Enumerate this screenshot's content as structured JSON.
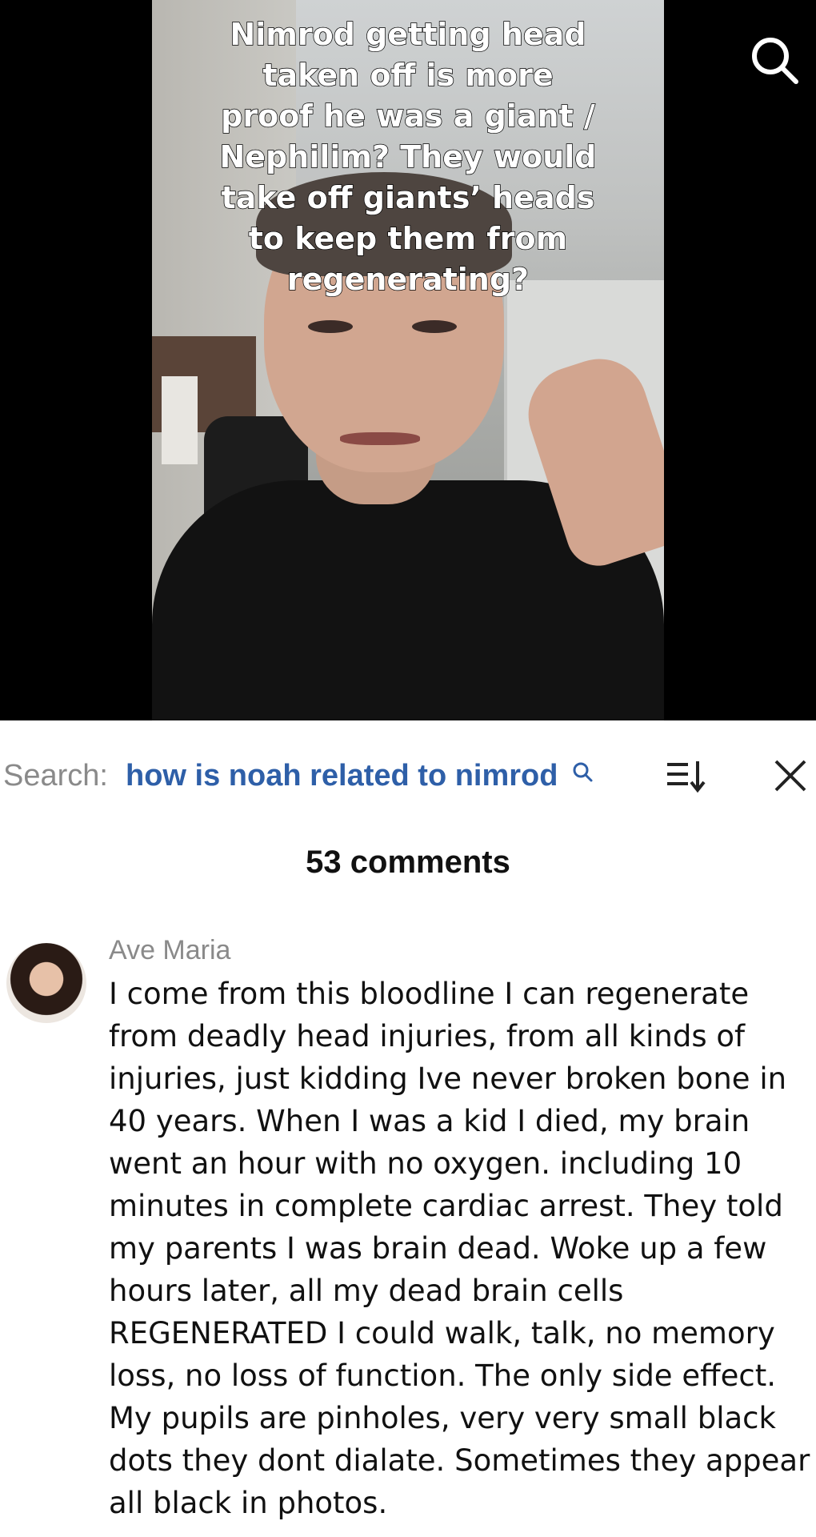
{
  "video": {
    "caption": "Nimrod getting head taken off is more proof he was a giant / Nephilim? They would take off giants’ heads to keep them from regenerating?"
  },
  "icons": {
    "top_search": "search-icon",
    "query_search": "search-icon",
    "sort": "sort-icon",
    "close": "close-icon"
  },
  "search": {
    "label": "Search:",
    "query": "how is noah related to nimrod"
  },
  "comments": {
    "count_label": "53 comments",
    "items": [
      {
        "author": "Ave Maria",
        "text": "I come from this bloodline I can regenerate from deadly head injuries, from all kinds of injuries, just kidding Ive never broken bone in 40 years. When I was a kid I died, my brain went an hour with no oxygen. including 10 minutes in complete cardiac arrest. They told my parents I was brain dead. Woke up a few hours later, all my dead brain cells REGENERATED I could walk, talk, no memory loss, no loss of function. The only side effect. My pupils are pinholes, very very small black dots they dont dialate. Sometimes they appear all black in photos."
      }
    ]
  },
  "colors": {
    "query_blue": "#2e5fa8",
    "muted_gray": "#8a8a8a"
  }
}
